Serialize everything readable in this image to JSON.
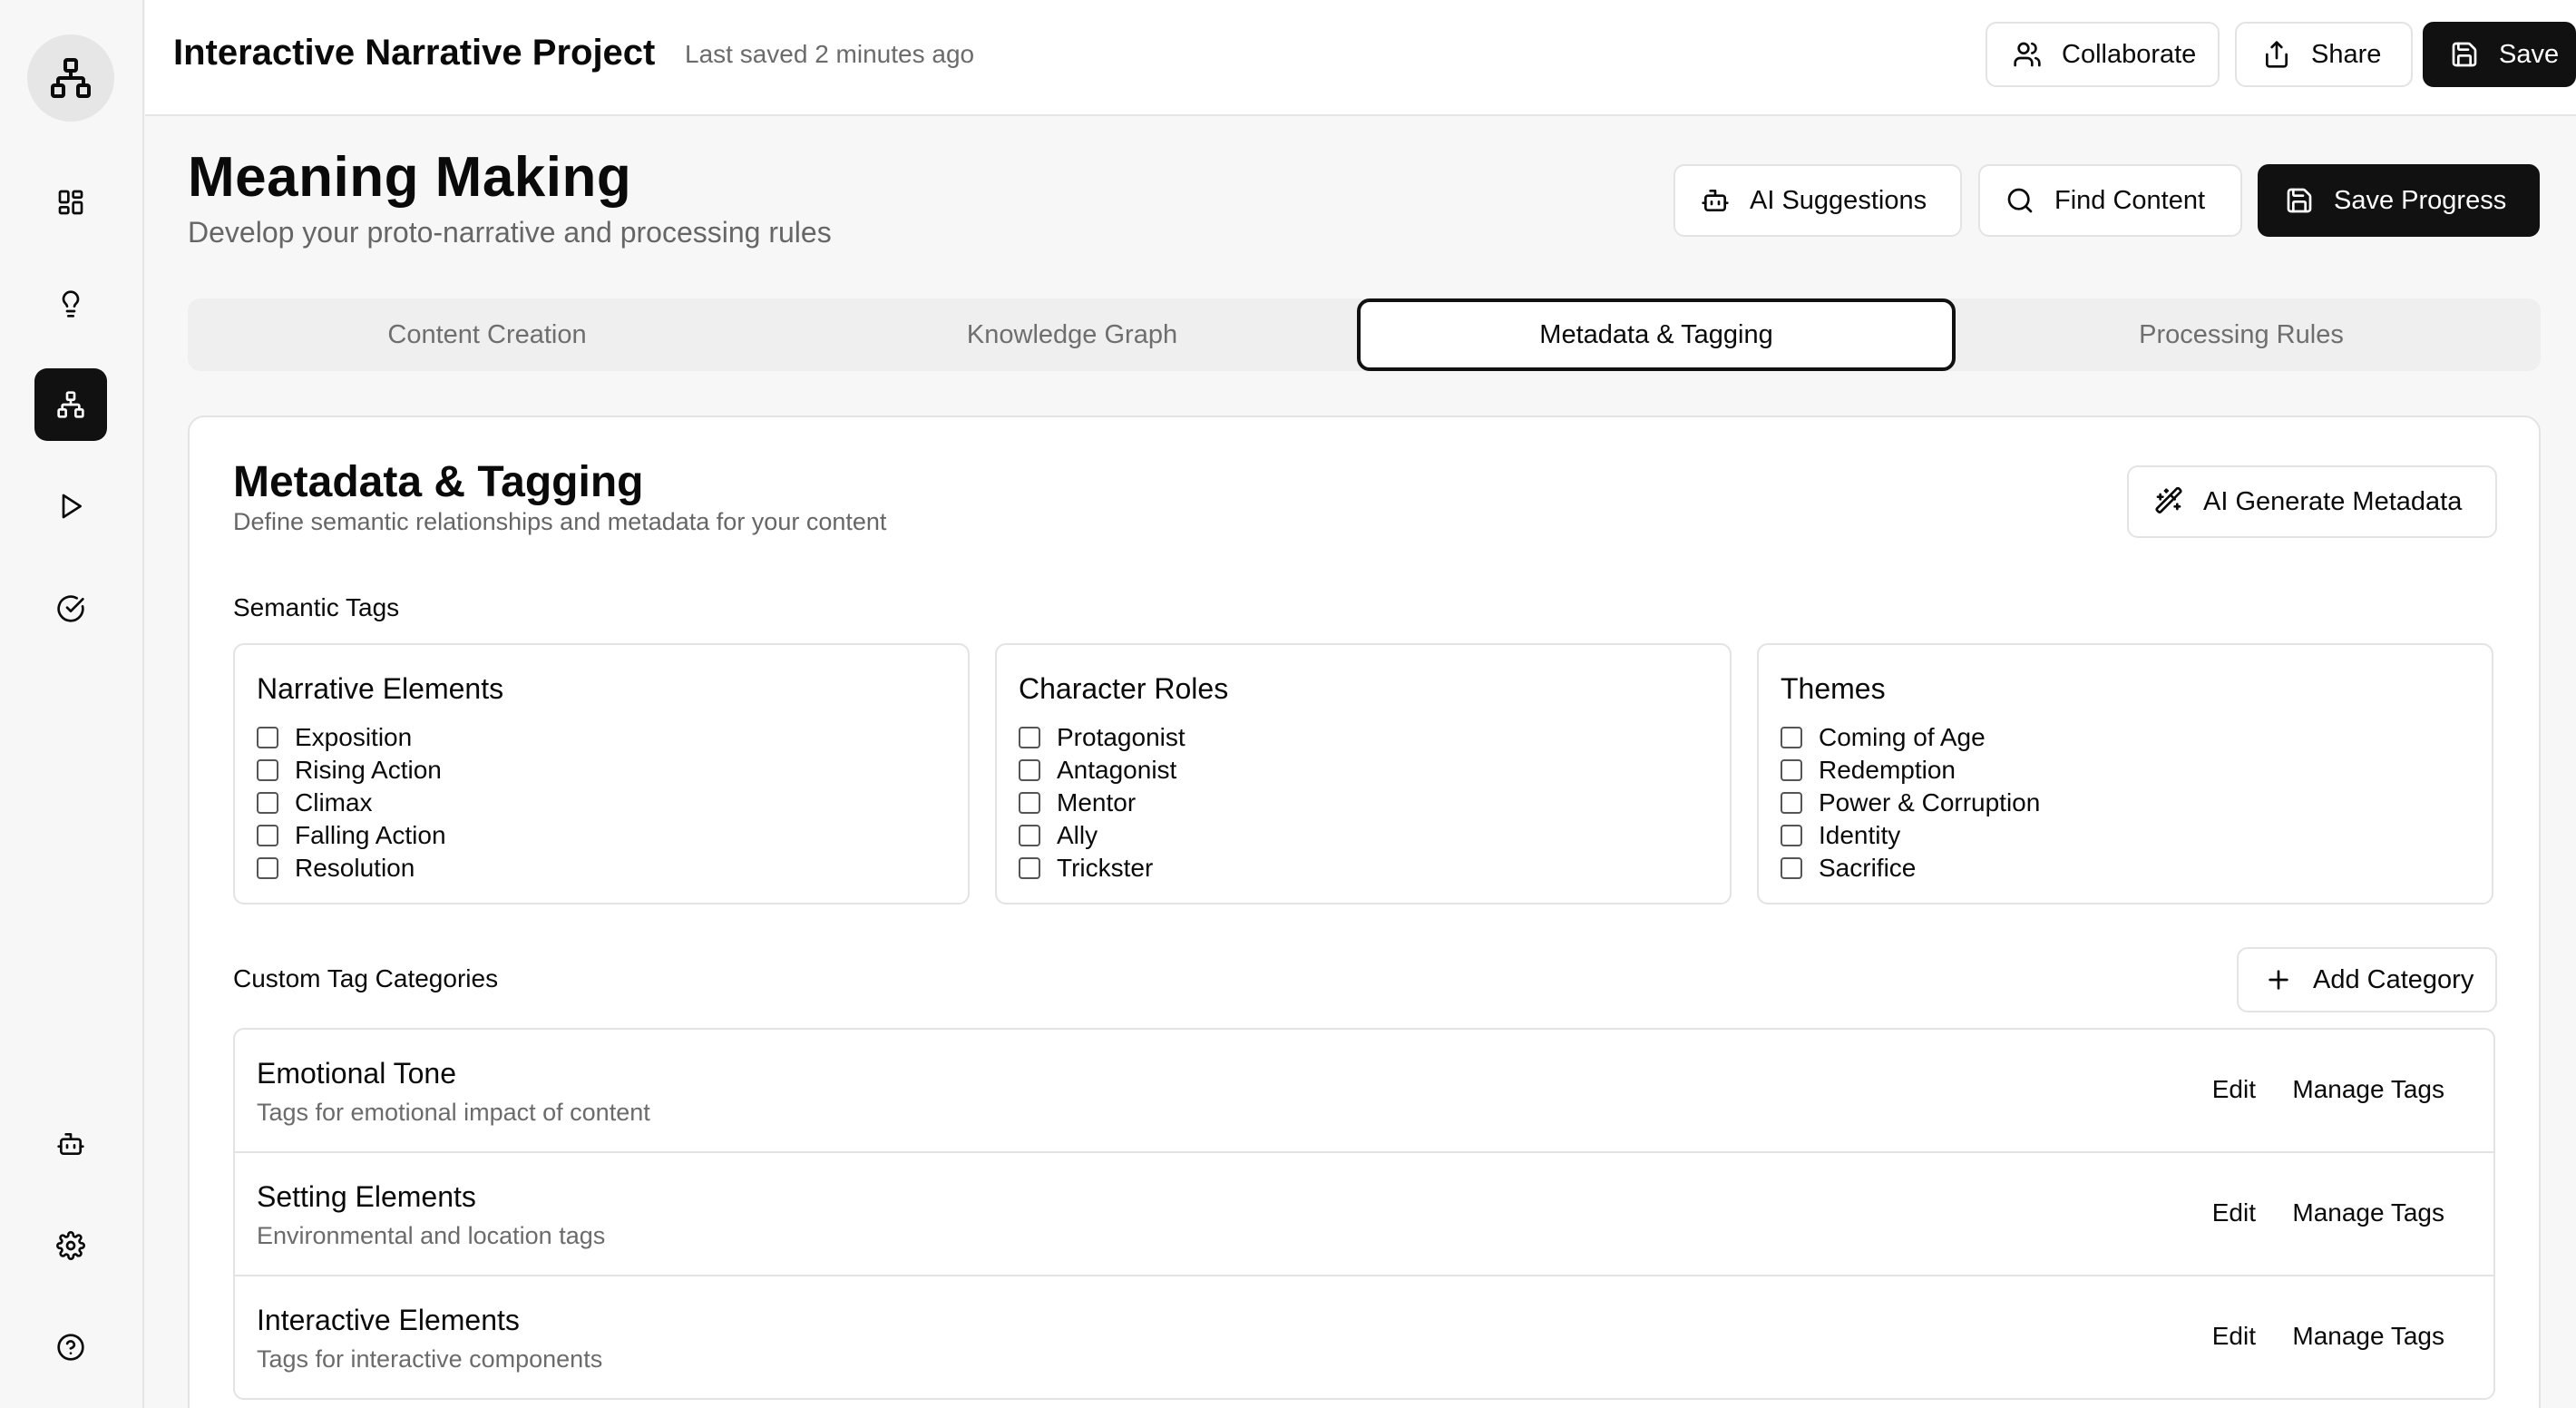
{
  "sidebar": {
    "items": [
      {
        "icon": "sitemap-icon"
      },
      {
        "icon": "dashboard-icon"
      },
      {
        "icon": "lightbulb-icon"
      },
      {
        "icon": "sitemap-icon",
        "active": true
      },
      {
        "icon": "play-icon"
      },
      {
        "icon": "check-circle-icon"
      },
      {
        "icon": "bot-icon"
      },
      {
        "icon": "gear-icon"
      },
      {
        "icon": "help-icon"
      }
    ]
  },
  "topbar": {
    "project_title": "Interactive Narrative Project",
    "saved_text": "Last saved 2 minutes ago",
    "collaborate_label": "Collaborate",
    "share_label": "Share",
    "save_label": "Save"
  },
  "header": {
    "title": "Meaning Making",
    "subtitle": "Develop your proto-narrative and processing rules",
    "ai_suggestions_label": "AI Suggestions",
    "find_content_label": "Find Content",
    "save_progress_label": "Save Progress"
  },
  "tabs": [
    {
      "label": "Content Creation",
      "active": false
    },
    {
      "label": "Knowledge Graph",
      "active": false
    },
    {
      "label": "Metadata & Tagging",
      "active": true
    },
    {
      "label": "Processing Rules",
      "active": false
    }
  ],
  "metadata": {
    "title": "Metadata & Tagging",
    "subtitle": "Define semantic relationships and metadata for your content",
    "ai_generate_label": "AI Generate Metadata",
    "semantic_tags_label": "Semantic Tags",
    "tag_groups": [
      {
        "title": "Narrative Elements",
        "tags": [
          "Exposition",
          "Rising Action",
          "Climax",
          "Falling Action",
          "Resolution"
        ]
      },
      {
        "title": "Character Roles",
        "tags": [
          "Protagonist",
          "Antagonist",
          "Mentor",
          "Ally",
          "Trickster"
        ]
      },
      {
        "title": "Themes",
        "tags": [
          "Coming of Age",
          "Redemption",
          "Power & Corruption",
          "Identity",
          "Sacrifice"
        ]
      }
    ],
    "custom_categories_label": "Custom Tag Categories",
    "add_category_label": "Add Category",
    "categories": [
      {
        "name": "Emotional Tone",
        "description": "Tags for emotional impact of content",
        "edit_label": "Edit",
        "manage_label": "Manage Tags"
      },
      {
        "name": "Setting Elements",
        "description": "Environmental and location tags",
        "edit_label": "Edit",
        "manage_label": "Manage Tags"
      },
      {
        "name": "Interactive Elements",
        "description": "Tags for interactive components",
        "edit_label": "Edit",
        "manage_label": "Manage Tags"
      }
    ]
  }
}
